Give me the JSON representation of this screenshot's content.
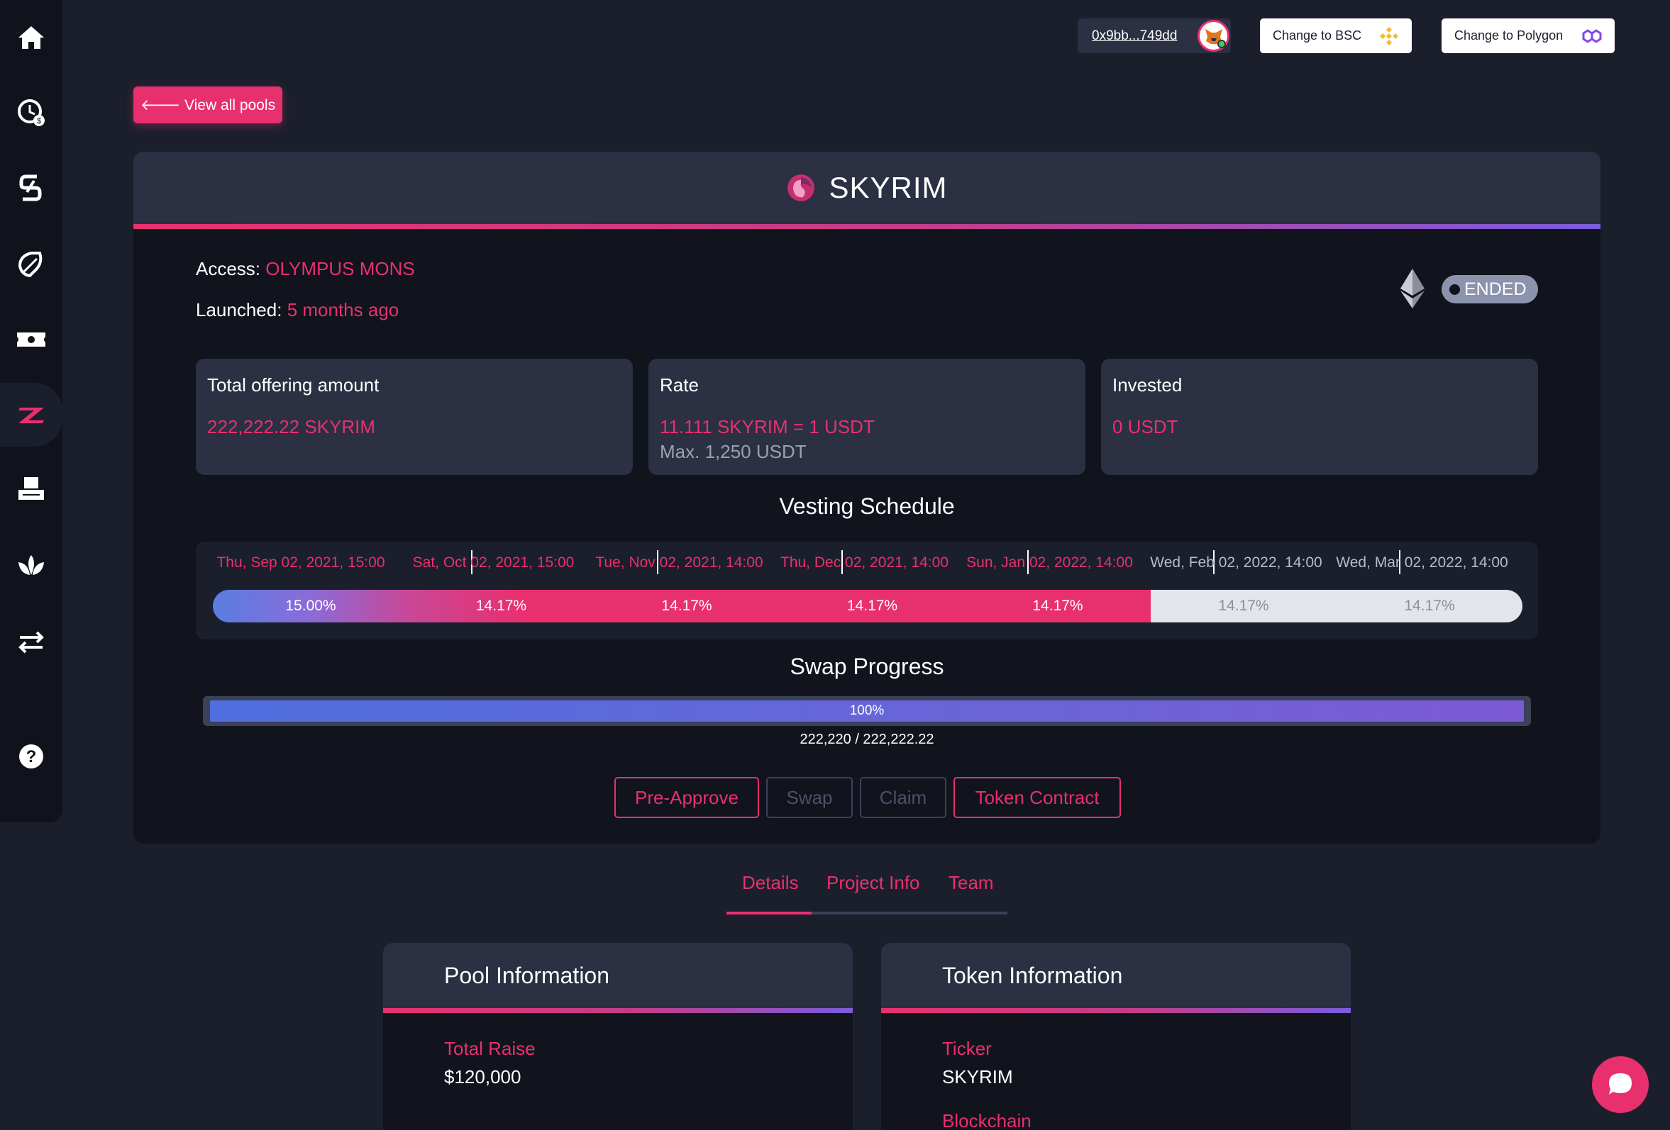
{
  "sidebar": {
    "items": [
      {
        "icon": "home-icon"
      },
      {
        "icon": "staking-clock-icon"
      },
      {
        "icon": "swap-s-icon"
      },
      {
        "icon": "leaf-icon"
      },
      {
        "icon": "ticket-icon"
      },
      {
        "icon": "launchpad-z-icon"
      },
      {
        "icon": "printer-icon"
      },
      {
        "icon": "lotus-icon"
      },
      {
        "icon": "transfer-icon"
      },
      {
        "icon": "help-icon"
      }
    ]
  },
  "header": {
    "wallet_address": "0x9bb...749dd",
    "change_bsc_label": "Change to BSC",
    "change_polygon_label": "Change to Polygon"
  },
  "view_all_label": "🡐 View all pools",
  "pool": {
    "title": "SKYRIM",
    "access_label": "Access:",
    "access_value": "OLYMPUS MONS",
    "launched_label": "Launched:",
    "launched_value": "5 months ago",
    "status": "ENDED",
    "stats": {
      "offering_title": "Total offering amount",
      "offering_value": "222,222.22 SKYRIM",
      "rate_title": "Rate",
      "rate_value": "11.111 SKYRIM = 1 USDT",
      "rate_max": "Max. 1,250 USDT",
      "invested_title": "Invested",
      "invested_value": "0 USDT"
    },
    "vesting": {
      "title": "Vesting Schedule",
      "dates": [
        "Thu, Sep 02, 2021, 15:00",
        "Sat, Oct 02, 2021, 15:00",
        "Tue, Nov 02, 2021, 14:00",
        "Thu, Dec 02, 2021, 14:00",
        "Sun, Jan 02, 2022, 14:00",
        "Wed, Feb 02, 2022, 14:00",
        "Wed, Mar 02, 2022, 14:00"
      ],
      "percents": [
        "15.00%",
        "14.17%",
        "14.17%",
        "14.17%",
        "14.17%",
        "14.17%",
        "14.17%"
      ],
      "unlocked_count": 5
    },
    "swap": {
      "title": "Swap Progress",
      "percent_label": "100%",
      "progress": 1.0,
      "count": "222,220 / 222,222.22"
    },
    "actions": {
      "pre_approve": "Pre-Approve",
      "swap": "Swap",
      "claim": "Claim",
      "token_contract": "Token Contract"
    }
  },
  "tabs": {
    "details": "Details",
    "project_info": "Project Info",
    "team": "Team"
  },
  "pool_info": {
    "title": "Pool Information",
    "total_raise_label": "Total Raise",
    "total_raise_value": "$120,000"
  },
  "token_info": {
    "title": "Token Information",
    "ticker_label": "Ticker",
    "ticker_value": "SKYRIM",
    "blockchain_label": "Blockchain"
  },
  "colors": {
    "accent": "#e8306f",
    "background": "#1b1f2c",
    "card": "#2b3042",
    "gradient_end": "#7a5cdc"
  }
}
